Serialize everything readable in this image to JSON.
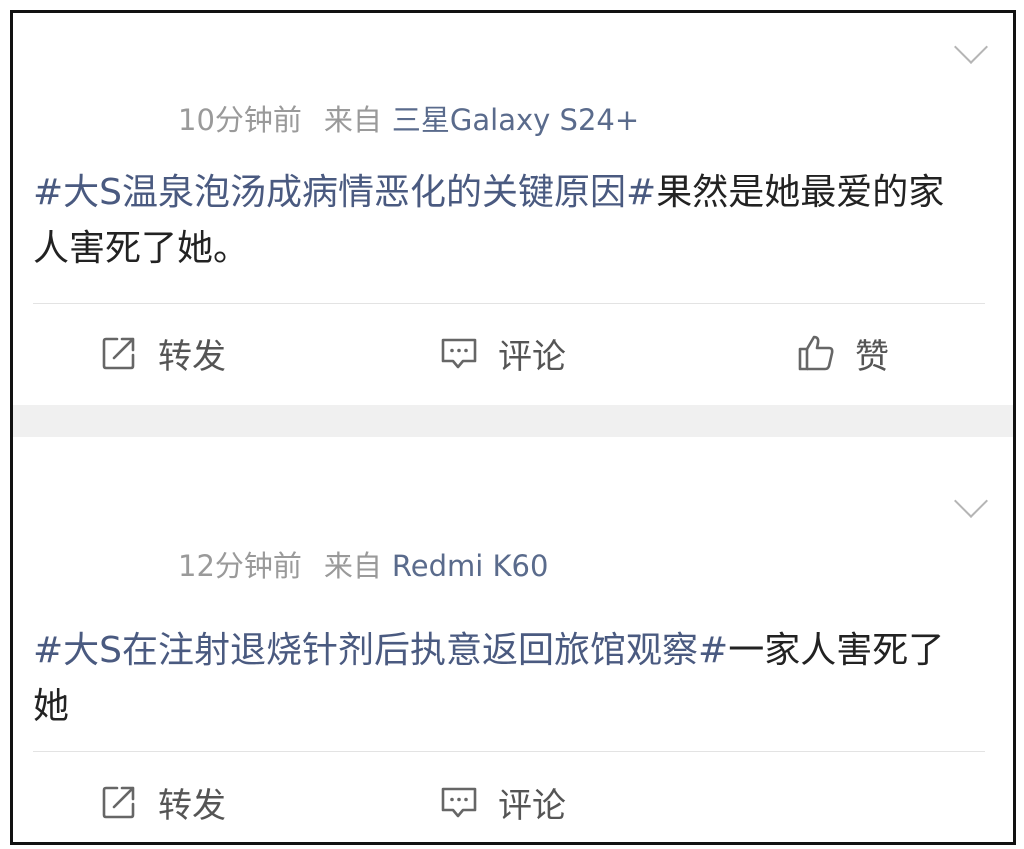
{
  "posts": [
    {
      "time": "10分钟前",
      "source_label": "来自",
      "device": "三星Galaxy S24+",
      "hashtag": "#大S温泉泡汤成病情恶化的关键原因#",
      "text": "果然是她最爱的家人害死了她。",
      "actions": {
        "repost": "转发",
        "comment": "评论",
        "like": "赞"
      }
    },
    {
      "time": "12分钟前",
      "source_label": "来自",
      "device": "Redmi K60",
      "hashtag": "#大S在注射退烧针剂后执意返回旅馆观察#",
      "text": "一家人害死了她",
      "actions": {
        "repost": "转发",
        "comment": "评论"
      }
    }
  ],
  "icons": {
    "repost": "share-icon",
    "comment": "comment-icon",
    "like": "thumbs-up-icon",
    "more": "chevron-down-icon"
  },
  "colors": {
    "hashtag": "#4a5a80",
    "meta": "#9a9a9a",
    "body_text": "#222222",
    "separator": "#f0f0f0"
  }
}
